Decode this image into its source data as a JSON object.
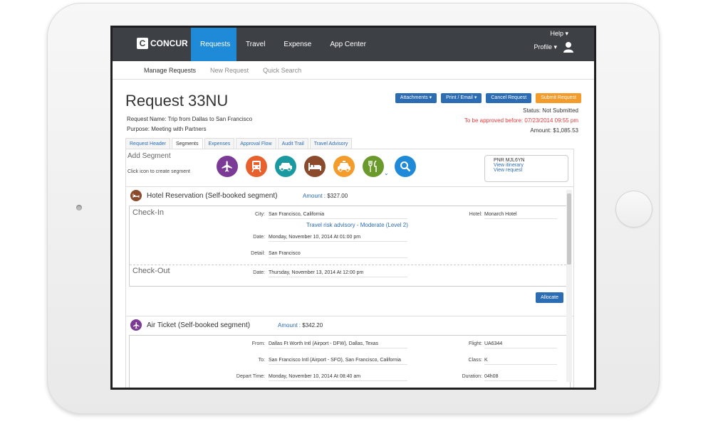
{
  "topbar": {
    "logo_text": "CONCUR",
    "nav": [
      "Requests",
      "Travel",
      "Expense",
      "App Center"
    ],
    "help": "Help",
    "profile": "Profile"
  },
  "subnav": [
    "Manage Requests",
    "New Request",
    "Quick Search"
  ],
  "page": {
    "title": "Request 33NU",
    "request_name_label": "Request Name:",
    "request_name": "Trip from Dallas to San Francisco",
    "purpose_label": "Purpose:",
    "purpose": "Meeting with Partners"
  },
  "buttons": {
    "attachments": "Attachments",
    "print_email": "Print / Email",
    "cancel": "Cancel Request",
    "submit": "Submit Request"
  },
  "status": {
    "status_label": "Status:",
    "status": "Not Submitted",
    "approve_label": "To be approved before:",
    "approve_date": "07/23/2014 09:55 pm",
    "amount_label": "Amount:",
    "amount": "$1,085.53"
  },
  "tabs": [
    "Request Header",
    "Segments",
    "Expenses",
    "Approval Flow",
    "Audit Trail",
    "Travel Advisory"
  ],
  "add_segment": {
    "title": "Add Segment",
    "hint": "Click icon to create segment",
    "icons": [
      {
        "name": "plane-icon",
        "color": "#7a3a95"
      },
      {
        "name": "train-icon",
        "color": "#e8612c"
      },
      {
        "name": "car-icon",
        "color": "#1a9aa0"
      },
      {
        "name": "bed-icon",
        "color": "#8b4a2b"
      },
      {
        "name": "taxi-icon",
        "color": "#f39c2b"
      },
      {
        "name": "dining-icon",
        "color": "#6a9a2c"
      },
      {
        "name": "search-icon",
        "color": "#1f8ad7"
      }
    ]
  },
  "pnr": {
    "code": "PNR MJL6YN",
    "view_itinerary": "View itinerary",
    "view_request": "View request"
  },
  "hotel": {
    "title": "Hotel Reservation (Self-booked segment)",
    "amount_label": "Amount :",
    "amount": "$327.00",
    "checkin": "Check-In",
    "checkout": "Check-Out",
    "city_label": "City:",
    "city": "San Francisco, California",
    "advisory": "Travel risk advisory - Moderate (Level 2)",
    "date_label": "Date:",
    "checkin_date": "Monday, November 10, 2014 At 01:00 pm",
    "detail_label": "Detail:",
    "detail": "San Francisco",
    "checkout_date": "Thursday, November 13, 2014 At 12:00 pm",
    "hotel_label": "Hotel:",
    "hotel": "Monarch Hotel",
    "allocate": "Allocate"
  },
  "air": {
    "title": "Air Ticket (Self-booked segment)",
    "amount_label": "Amount :",
    "amount": "$342.20",
    "from_label": "From:",
    "from": "Dallas Ft Worth Intl (Airport - DFW), Dallas, Texas",
    "to_label": "To:",
    "to": "San Francisco Intl (Airport - SFO), San Francisco, California",
    "depart_label": "Depart Time:",
    "depart": "Monday, November 10, 2014 At 08:40 am",
    "flight_label": "Flight:",
    "flight": "UA6344",
    "class_label": "Class:",
    "class": "K",
    "duration_label": "Duration:",
    "duration": "04h08"
  }
}
